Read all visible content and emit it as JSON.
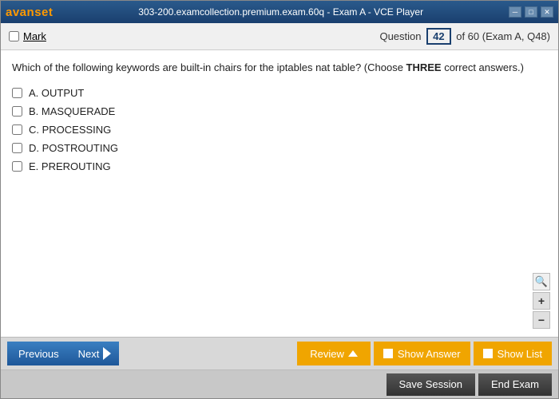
{
  "titleBar": {
    "logo": "avan",
    "logoAccent": "set",
    "title": "303-200.examcollection.premium.exam.60q - Exam A - VCE Player",
    "controls": {
      "minimize": "─",
      "maximize": "□",
      "close": "✕"
    }
  },
  "toolbar": {
    "markLabel": "Mark",
    "questionLabel": "Question",
    "questionNumber": "42",
    "questionTotal": "of 60 (Exam A, Q48)"
  },
  "question": {
    "text": "Which of the following keywords are built-in chairs for the iptables nat table? (Choose ",
    "boldText": "THREE",
    "textSuffix": " correct answers.)",
    "options": [
      {
        "id": "A",
        "label": "A.  OUTPUT"
      },
      {
        "id": "B",
        "label": "B.  MASQUERADE"
      },
      {
        "id": "C",
        "label": "C.  PROCESSING"
      },
      {
        "id": "D",
        "label": "D.  POSTROUTING"
      },
      {
        "id": "E",
        "label": "E.  PREROUTING"
      }
    ]
  },
  "nav": {
    "previousLabel": "Previous",
    "nextLabel": "Next",
    "reviewLabel": "Review",
    "showAnswerLabel": "Show Answer",
    "showListLabel": "Show List",
    "saveSessionLabel": "Save Session",
    "endExamLabel": "End Exam"
  },
  "zoom": {
    "searchIcon": "🔍",
    "plusIcon": "+",
    "minusIcon": "−"
  }
}
